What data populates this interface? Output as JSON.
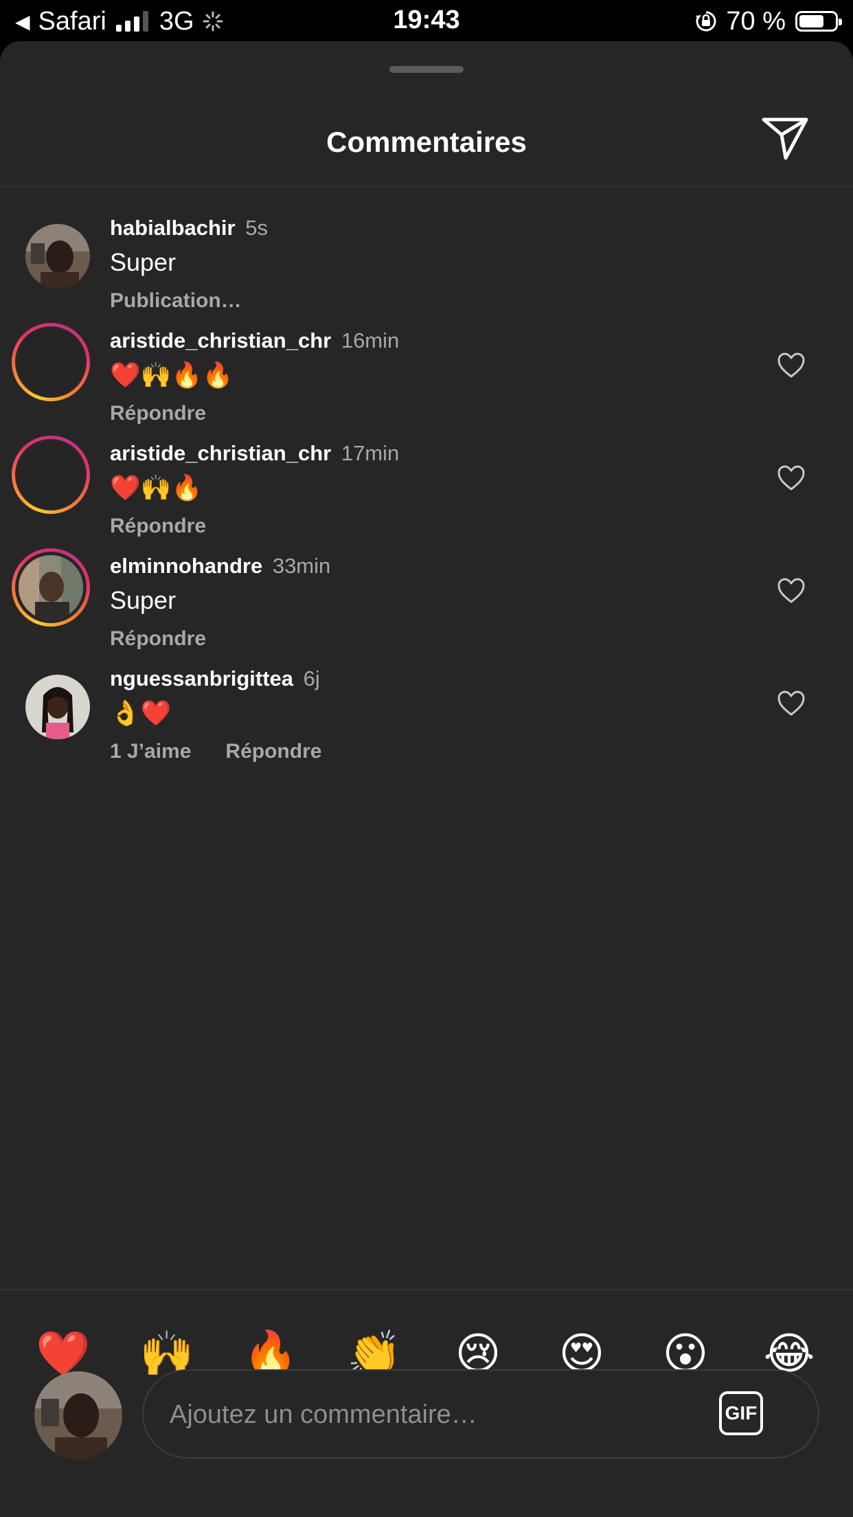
{
  "status_bar": {
    "back_app": "Safari",
    "network": "3G",
    "time": "19:43",
    "battery_percent": "70 %",
    "battery_level": 0.7
  },
  "sheet": {
    "title": "Commentaires",
    "icons": {
      "share": "send-icon",
      "like": "heart-outline-icon"
    }
  },
  "comments": [
    {
      "username": "habialbachir",
      "time": "5s",
      "text": "Super",
      "action_status": "Publication…"
    },
    {
      "username": "aristide_christian_chr",
      "time": "16min",
      "text": "❤️🙌🔥🔥",
      "reply": "Répondre"
    },
    {
      "username": "aristide_christian_chr",
      "time": "17min",
      "text": "❤️🙌🔥",
      "reply": "Répondre"
    },
    {
      "username": "elminnohandre",
      "time": "33min",
      "text": "Super",
      "reply": "Répondre"
    },
    {
      "username": "nguessanbrigittea",
      "time": "6j",
      "text": "👌❤️",
      "likes": "1 J’aime",
      "reply": "Répondre"
    }
  ],
  "quick_emojis": [
    "❤️",
    "🙌",
    "🔥",
    "👏",
    "😢",
    "😍",
    "😮",
    "😂"
  ],
  "composer": {
    "placeholder": "Ajoutez un commentaire…",
    "gif_label": "GIF"
  },
  "colors": {
    "sheet_bg": "#262626",
    "secondary_text": "#a8a8a8",
    "story_ring": [
      "#fdc830",
      "#e1306c",
      "#c13584"
    ]
  }
}
